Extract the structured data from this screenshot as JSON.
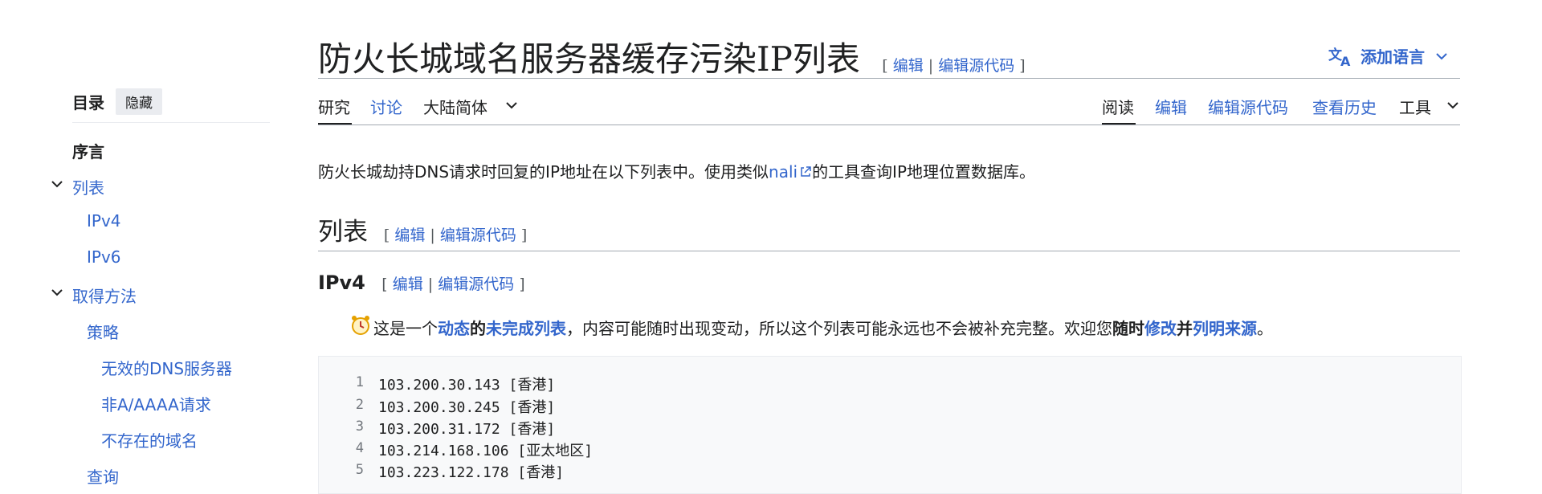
{
  "toc": {
    "title": "目录",
    "hide_label": "隐藏",
    "items": [
      {
        "label": "序言"
      },
      {
        "label": "列表"
      },
      {
        "label": "IPv4"
      },
      {
        "label": "IPv6"
      },
      {
        "label": "取得方法"
      },
      {
        "label": "策略"
      },
      {
        "label": "无效的DNS服务器"
      },
      {
        "label": "非A/AAAA请求"
      },
      {
        "label": "不存在的域名"
      },
      {
        "label": "查询"
      }
    ]
  },
  "header": {
    "title": "防火长城域名服务器缓存污染IP列表",
    "edit_open": "[",
    "edit_label": "编辑",
    "sep": "|",
    "edit_source_label": "编辑源代码",
    "edit_close": "]",
    "add_language": "添加语言"
  },
  "tabs_left": [
    {
      "label": "研究"
    },
    {
      "label": "讨论"
    },
    {
      "label": "大陆简体"
    }
  ],
  "tabs_right": [
    {
      "label": "阅读"
    },
    {
      "label": "编辑"
    },
    {
      "label": "编辑源代码"
    },
    {
      "label": "查看历史"
    },
    {
      "label": "工具"
    }
  ],
  "intro": {
    "before": "防火长城劫持DNS请求时回复的IP地址在以下列表中。使用类似",
    "link": "nali",
    "after": "的工具查询IP地理位置数据库。"
  },
  "section_list": {
    "title": "列表"
  },
  "section_ipv4": {
    "title": "IPv4"
  },
  "notice": {
    "t1": "这是一个",
    "l1": "动态",
    "t2": "的",
    "l2": "未完成列表",
    "t3": "，内容可能随时出现变动，所以这个列表可能永远也不会被补充完整。欢迎您",
    "b1": "随时",
    "l3": "修改",
    "b2": "并",
    "l4": "列明来源",
    "t4": "。"
  },
  "code_lines": [
    {
      "n": "1",
      "text": "103.200.30.143 [香港]"
    },
    {
      "n": "2",
      "text": "103.200.30.245 [香港]"
    },
    {
      "n": "3",
      "text": "103.200.31.172 [香港]"
    },
    {
      "n": "4",
      "text": "103.214.168.106 [亚太地区]"
    },
    {
      "n": "5",
      "text": "103.223.122.178 [香港]"
    }
  ],
  "colors": {
    "link": "#3366cc",
    "text": "#202122",
    "muted": "#54595d"
  }
}
